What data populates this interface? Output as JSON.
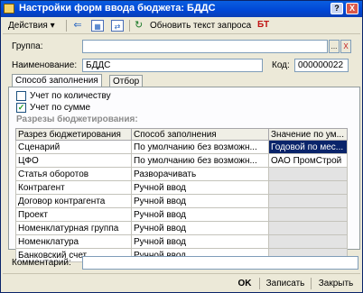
{
  "window": {
    "title": "Настройки форм ввода бюджета: БДДС",
    "help_btn": "?",
    "close_btn": "X"
  },
  "toolbar": {
    "actions_label": "Действия ▾",
    "refresh_label": "Обновить текст запроса",
    "bt_label": "БТ"
  },
  "form": {
    "group_label": "Группа:",
    "group_value": "",
    "group_btn": "...",
    "group_clear": "X",
    "name_label": "Наименование:",
    "name_value": "БДДС",
    "code_label": "Код:",
    "code_value": "000000022"
  },
  "tabs": [
    {
      "label": "Способ заполнения",
      "active": true
    },
    {
      "label": "Отбор",
      "active": false
    }
  ],
  "options": {
    "by_quantity_label": "Учет по количеству",
    "by_quantity_checked": false,
    "by_sum_label": "Учет по сумме",
    "by_sum_checked": true,
    "check_mark": "✓"
  },
  "section_title": "Разрезы бюджетирования:",
  "table": {
    "headers": [
      "Разрез бюджетирования",
      "Способ заполнения",
      "Значение по ум..."
    ],
    "rows": [
      {
        "cut": "Сценарий",
        "fill": "По умолчанию без возможн...",
        "value": "Годовой по мес..."
      },
      {
        "cut": "ЦФО",
        "fill": "По умолчанию без возможн...",
        "value": "ОАО ПромСтрой"
      },
      {
        "cut": "Статья оборотов",
        "fill": "Разворачивать",
        "value": ""
      },
      {
        "cut": "Контрагент",
        "fill": "Ручной ввод",
        "value": ""
      },
      {
        "cut": "Договор контрагента",
        "fill": "Ручной ввод",
        "value": ""
      },
      {
        "cut": "Проект",
        "fill": "Ручной ввод",
        "value": ""
      },
      {
        "cut": "Номенклатурная группа",
        "fill": "Ручной ввод",
        "value": ""
      },
      {
        "cut": "Номенклатура",
        "fill": "Ручной ввод",
        "value": ""
      },
      {
        "cut": "Банковский счет",
        "fill": "Ручной ввод",
        "value": ""
      }
    ]
  },
  "comment": {
    "label": "Комментарий:",
    "value": ""
  },
  "buttons": {
    "ok": "OK",
    "save": "Записать",
    "close": "Закрыть"
  },
  "colors": {
    "titlebar": "#0046d5",
    "selection": "#0a246a",
    "window_bg": "#ece9d8"
  }
}
